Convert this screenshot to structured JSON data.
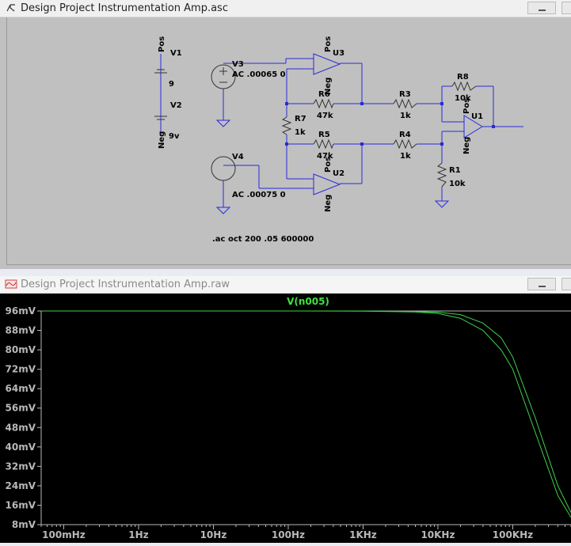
{
  "schematic_window": {
    "title": "Design Project Instrumentation Amp.asc",
    "labels": {
      "v1": "V1",
      "v2": "V2",
      "v1_value": "9",
      "v2_value": "9v",
      "pos_top": "Pos",
      "neg_bottom": "Neg",
      "v3": "V3",
      "v3_value": "AC .00065 0",
      "v4": "V4",
      "v4_value": "AC .00075 0",
      "u1": "U1",
      "u2": "U2",
      "u3": "U3",
      "u1_pos": "Pos",
      "u1_neg": "Neg",
      "u2_pos": "Pos",
      "u2_neg": "Neg",
      "u3_pos": "Pos",
      "u3_neg": "Neg",
      "r1": "R1",
      "r1_value": "10k",
      "r3": "R3",
      "r3_value": "1k",
      "r4": "R4",
      "r4_value": "1k",
      "r5": "R5",
      "r5_value": "47k",
      "r6": "R6",
      "r6_value": "47k",
      "r7": "R7",
      "r7_value": "1k",
      "r8": "R8",
      "r8_value": "10k",
      "directive": ".ac oct 200 .05 600000"
    }
  },
  "waveform_window": {
    "title": "Design Project Instrumentation Amp.raw"
  },
  "chart_data": {
    "type": "line",
    "trace_label": "V(n005)",
    "x_scale": "log",
    "xlim": [
      0.05,
      600000
    ],
    "ylim": [
      8,
      96
    ],
    "x_tick_labels": [
      "100mHz",
      "1Hz",
      "10Hz",
      "100Hz",
      "1KHz",
      "10KHz",
      "100KHz"
    ],
    "x_tick_values": [
      0.1,
      1,
      10,
      100,
      1000,
      10000,
      100000
    ],
    "y_tick_labels": [
      "96mV",
      "88mV",
      "80mV",
      "72mV",
      "64mV",
      "56mV",
      "48mV",
      "40mV",
      "32mV",
      "24mV",
      "16mV",
      "8mV"
    ],
    "y_tick_values": [
      96,
      88,
      80,
      72,
      64,
      56,
      48,
      40,
      32,
      24,
      16,
      8
    ],
    "colors": {
      "trace": "#3fd04a",
      "axes": "#b8b8b8",
      "background": "#000000",
      "label": "#40e040"
    },
    "series": [
      {
        "x": [
          0.05,
          1,
          100,
          1000,
          5000,
          10000,
          20000,
          40000,
          70000,
          100000,
          200000,
          400000,
          600000
        ],
        "y": [
          96,
          96,
          96,
          96,
          95.8,
          95.5,
          94.5,
          91,
          85,
          77,
          52,
          24,
          13
        ]
      },
      {
        "x": [
          0.05,
          1,
          100,
          1000,
          5000,
          10000,
          20000,
          40000,
          70000,
          100000,
          200000,
          400000,
          600000
        ],
        "y": [
          96,
          96,
          96,
          95.9,
          95.6,
          95,
          93,
          88,
          80,
          72,
          46,
          20,
          11
        ]
      }
    ]
  }
}
